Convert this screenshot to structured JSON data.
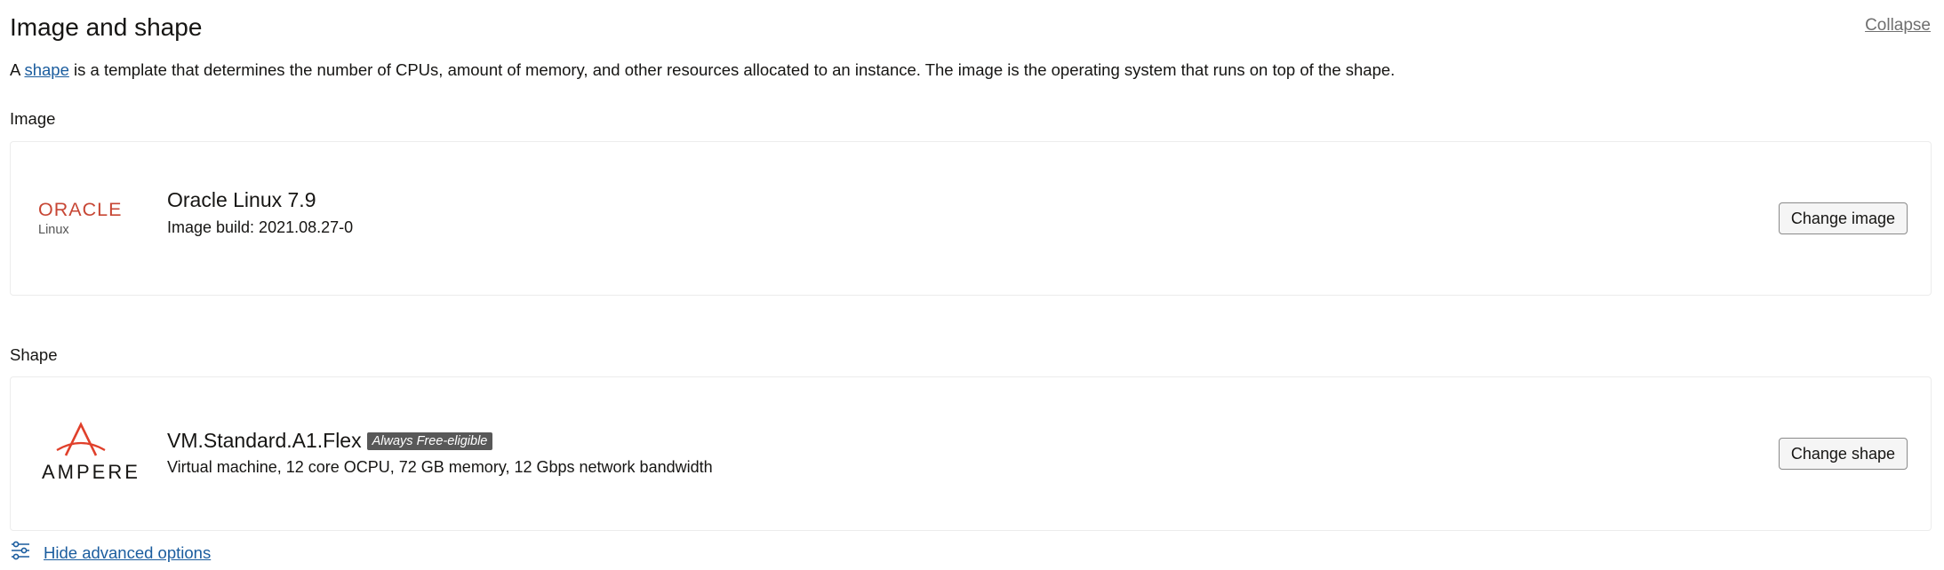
{
  "section": {
    "title": "Image and shape",
    "collapse_label": "Collapse"
  },
  "description": {
    "prefix": "A ",
    "link": "shape",
    "suffix": " is a template that determines the number of CPUs, amount of memory, and other resources allocated to an instance. The image is the operating system that runs on top of the shape."
  },
  "image": {
    "label": "Image",
    "logo_text": "ORACLE",
    "logo_subtext": "Linux",
    "name": "Oracle Linux 7.9",
    "build": "Image build: 2021.08.27-0",
    "button_label": "Change image"
  },
  "shape": {
    "label": "Shape",
    "logo_text": "AMPERE",
    "name": "VM.Standard.A1.Flex",
    "badge": "Always Free-eligible",
    "details": "Virtual machine, 12 core OCPU, 72 GB memory, 12 Gbps network bandwidth",
    "button_label": "Change shape"
  },
  "advanced": {
    "label": "Hide advanced options",
    "icon": "sliders-icon"
  },
  "colors": {
    "oracle_red": "#c74634",
    "ampere_red": "#e0402b",
    "link_blue": "#1a5c9e",
    "badge_bg": "#585858"
  }
}
